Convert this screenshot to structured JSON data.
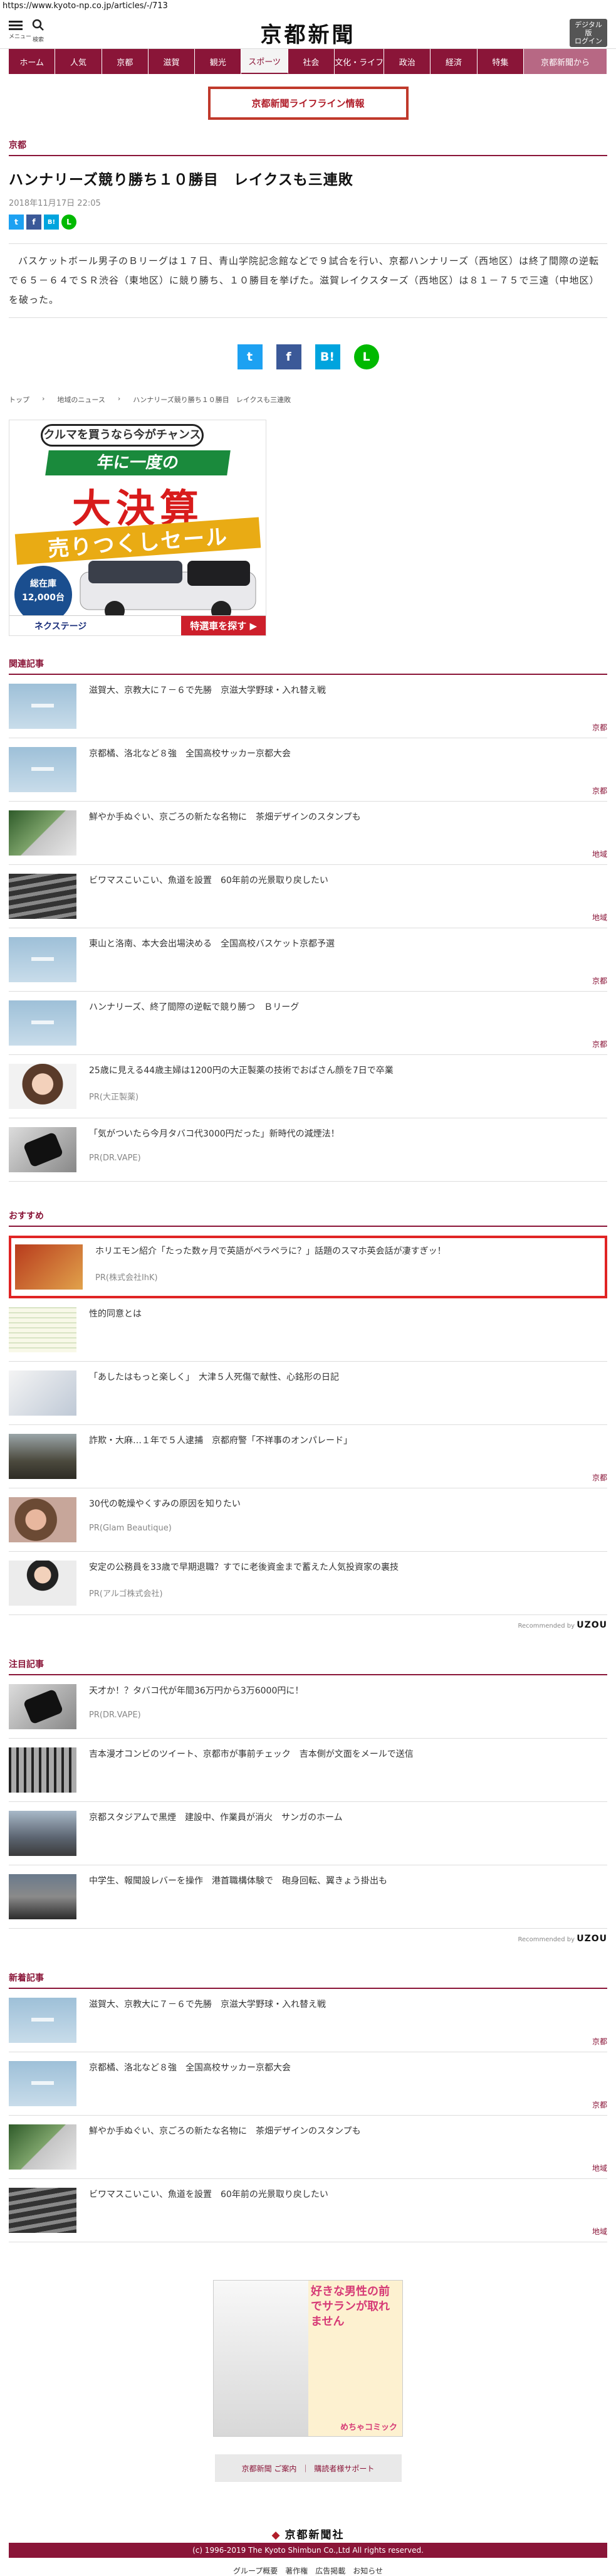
{
  "url": "https://www.kyoto-np.co.jp/articles/-/713",
  "header": {
    "menu_label": "メニュー",
    "search_label": "検索",
    "logo": "京都新聞",
    "digital_line1": "デジタル版",
    "digital_line2": "ログイン"
  },
  "gnav": [
    "ホーム",
    "人気",
    "京都",
    "滋賀",
    "観光",
    "スポーツ",
    "社会",
    "文化・ライフ",
    "政治",
    "経済",
    "特集",
    "京都新聞から"
  ],
  "lifeline": "京都新聞ライフライン情報",
  "article": {
    "category": "京都",
    "title": "ハンナリーズ競り勝ち１０勝目　レイクスも三連敗",
    "date": "2018年11月17日 22:05",
    "body": "バスケットボール男子のＢリーグは１７日、青山学院記念館などで９試合を行い、京都ハンナリーズ（西地区）は終了間際の逆転で６５－６４でＳＲ渋谷（東地区）に競り勝ち、１０勝目を挙げた。滋賀レイクスターズ（西地区）は８１－７５で三遠（中地区）を破った。",
    "share_small": [
      "t",
      "f",
      "B!",
      "L"
    ]
  },
  "share_big": [
    "t",
    "f",
    "B!",
    "L"
  ],
  "breadcrumb": [
    "トップ",
    "地域のニュース",
    "ハンナリーズ競り勝ち１０勝目　レイクスも三連敗"
  ],
  "ad_banner": {
    "top": "クルマを買うなら今がチャンス",
    "ribbon": "年に一度の",
    "big": "大決算",
    "sale": "売りつくしセール",
    "stock_line1": "総在庫",
    "stock_line2": "12,000台",
    "brand": "ネクステージ",
    "cta": "特選車を探す ▶"
  },
  "related": {
    "heading": "関連記事",
    "items": [
      {
        "title": "滋賀大、京教大に７－６で先勝　京滋大学野球・入れ替え戦",
        "tag": "京都",
        "thumb": "noimg"
      },
      {
        "title": "京都橘、洛北など８強　全国高校サッカー京都大会",
        "tag": "京都",
        "thumb": "noimg"
      },
      {
        "title": "鮮やか手ぬぐい、京ごろの新たな名物に　茶畑デザインのスタンプも",
        "tag": "地域",
        "thumb": "green"
      },
      {
        "title": "ビワマスこいこい、魚道を設置　60年前の光景取り戻したい",
        "tag": "地域",
        "thumb": "stairs"
      },
      {
        "title": "東山と洛南、本大会出場決める　全国高校バスケット京都予選",
        "tag": "京都",
        "thumb": "noimg"
      },
      {
        "title": "ハンナリーズ、終了間際の逆転で競り勝つ　Ｂリーグ",
        "tag": "京都",
        "thumb": "noimg"
      },
      {
        "title": "25歳に見える44歳主婦は1200円の大正製薬の技術でおばさん顔を7日で卒業",
        "pr": "PR(大正製薬)",
        "thumb": "woman"
      },
      {
        "title": "「気がついたら今月タバコ代3000円だった」新時代の減煙法！",
        "pr": "PR(DR.VAPE)",
        "thumb": "vape"
      }
    ]
  },
  "recommend": {
    "heading": "おすすめ",
    "items": [
      {
        "title": "ホリエモン紹介「たった数ヶ月で英語がペラペラに？」話題のスマホ英会話が凄すぎッ！",
        "pr": "PR(株式会社IhK)",
        "thumb": "book",
        "highlight": true
      },
      {
        "title": "性的同意とは",
        "thumb": "paper"
      },
      {
        "title": "「あしたはもっと楽しく」　大津５人死傷で献性、心銘形の日記",
        "thumb": "sketch"
      },
      {
        "title": "詐欺・大麻…１年で５人逮捕　京都府警「不祥事のオンパレード」",
        "tag": "京都",
        "thumb": "building"
      },
      {
        "title": "30代の乾燥やくすみの原因を知りたい",
        "pr": "PR(Glam Beautique)",
        "thumb": "face"
      },
      {
        "title": "安定の公務員を33歳で早期退職？すでに老後資金まで蓄えた人気投資家の裏技",
        "pr": "PR(アルゴ株式会社)",
        "thumb": "suit"
      }
    ],
    "recommended_by": "Recommended by",
    "uzou": "UZOU"
  },
  "attention": {
    "heading": "注目記事",
    "items": [
      {
        "title": "天才か！？タバコ代が年間36万円から3万6000円に！",
        "pr": "PR(DR.VAPE)",
        "thumb": "vape"
      },
      {
        "title": "吉本漫才コンビのツイート、京都市が事前チェック　吉本側が文面をメールで送信",
        "thumb": "grid"
      },
      {
        "title": "京都スタジアムで黒煙　建設中、作業員が消火　サンガのホーム",
        "thumb": "street"
      },
      {
        "title": "中学生、報聞設レバーを操作　港首職構体験で　砲身回転、翼きょう掛出も",
        "thumb": "crowd"
      }
    ],
    "recommended_by": "Recommended by",
    "uzou": "UZOU"
  },
  "latest": {
    "heading": "新着記事",
    "items": [
      {
        "title": "滋賀大、京教大に７－６で先勝　京滋大学野球・入れ替え戦",
        "tag": "京都",
        "thumb": "noimg"
      },
      {
        "title": "京都橘、洛北など８強　全国高校サッカー京都大会",
        "tag": "京都",
        "thumb": "noimg"
      },
      {
        "title": "鮮やか手ぬぐい、京ごろの新たな名物に　茶畑デザインのスタンプも",
        "tag": "地域",
        "thumb": "green"
      },
      {
        "title": "ビワマスこいこい、魚道を設置　60年前の光景取り戻したい",
        "tag": "地域",
        "thumb": "stairs"
      }
    ]
  },
  "ad2": {
    "title": "好きな男性の前でサランが取れません",
    "logo": "めちゃコミック"
  },
  "support": {
    "left": "京都新聞 ご案内",
    "sep": "｜",
    "right": "購読者様サポート"
  },
  "footer": {
    "logo": "京都新聞社",
    "nav": [
      "グループ概要",
      "著作権",
      "広告掲載",
      "お知らせ"
    ],
    "copyright": "(c) 1996-2019 The Kyoto Shimbun Co.,Ltd All rights reserved."
  },
  "colors": {
    "brand": "#8a1538",
    "highlight": "#e02424",
    "lifeline": "#b01e2a"
  }
}
